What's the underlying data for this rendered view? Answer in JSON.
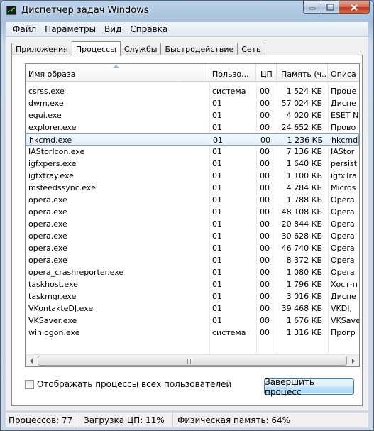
{
  "window": {
    "title": "Диспетчер задач Windows"
  },
  "menu": [
    {
      "first": "Ф",
      "rest": "айл"
    },
    {
      "first": "П",
      "rest": "араметры"
    },
    {
      "first": "В",
      "rest": "ид"
    },
    {
      "first": "С",
      "rest": "правка"
    }
  ],
  "tabs": [
    "Приложения",
    "Процессы",
    "Службы",
    "Быстродействие",
    "Сеть"
  ],
  "active_tab": 1,
  "columns": {
    "name": "Имя образа",
    "user": "Пользо...",
    "cpu": "ЦП",
    "mem": "Память (ч...",
    "desc": "Описа"
  },
  "processes": [
    {
      "name": "csrss.exe",
      "user": "система",
      "cpu": "00",
      "mem": "1 524 КБ",
      "desc": "Проце"
    },
    {
      "name": "dwm.exe",
      "user": "01",
      "cpu": "00",
      "mem": "57 024 КБ",
      "desc": "Диспе"
    },
    {
      "name": "egui.exe",
      "user": "01",
      "cpu": "00",
      "mem": "4 020 КБ",
      "desc": "ESET N"
    },
    {
      "name": "explorer.exe",
      "user": "01",
      "cpu": "00",
      "mem": "24 652 КБ",
      "desc": "Прово"
    },
    {
      "name": "hkcmd.exe",
      "user": "01",
      "cpu": "00",
      "mem": "1 236 КБ",
      "desc": "hkcmd"
    },
    {
      "name": "IAStorIcon.exe",
      "user": "01",
      "cpu": "00",
      "mem": "7 136 КБ",
      "desc": "IAStor"
    },
    {
      "name": "igfxpers.exe",
      "user": "01",
      "cpu": "00",
      "mem": "1 640 КБ",
      "desc": "persist"
    },
    {
      "name": "igfxtray.exe",
      "user": "01",
      "cpu": "00",
      "mem": "1 100 КБ",
      "desc": "igfxTra"
    },
    {
      "name": "msfeedssync.exe",
      "user": "01",
      "cpu": "00",
      "mem": "4 284 КБ",
      "desc": "Micros"
    },
    {
      "name": "opera.exe",
      "user": "01",
      "cpu": "00",
      "mem": "1 788 КБ",
      "desc": "Opera"
    },
    {
      "name": "opera.exe",
      "user": "01",
      "cpu": "00",
      "mem": "48 108 КБ",
      "desc": "Opera"
    },
    {
      "name": "opera.exe",
      "user": "01",
      "cpu": "00",
      "mem": "20 844 КБ",
      "desc": "Opera"
    },
    {
      "name": "opera.exe",
      "user": "01",
      "cpu": "00",
      "mem": "30 628 КБ",
      "desc": "Opera"
    },
    {
      "name": "opera.exe",
      "user": "01",
      "cpu": "00",
      "mem": "46 740 КБ",
      "desc": "Opera"
    },
    {
      "name": "opera.exe",
      "user": "01",
      "cpu": "00",
      "mem": "8 372 КБ",
      "desc": "Opera"
    },
    {
      "name": "opera_crashreporter.exe",
      "user": "01",
      "cpu": "00",
      "mem": "1 080 КБ",
      "desc": "Opera"
    },
    {
      "name": "taskhost.exe",
      "user": "01",
      "cpu": "00",
      "mem": "1 796 КБ",
      "desc": "Хост-п"
    },
    {
      "name": "taskmgr.exe",
      "user": "01",
      "cpu": "00",
      "mem": "3 016 КБ",
      "desc": "Диспе"
    },
    {
      "name": "VKontakteDJ.exe",
      "user": "01",
      "cpu": "00",
      "mem": "39 468 КБ",
      "desc": "VKDJ,"
    },
    {
      "name": "VKSaver.exe",
      "user": "01",
      "cpu": "00",
      "mem": "1 676 КБ",
      "desc": "VKSave"
    },
    {
      "name": "winlogon.exe",
      "user": "система",
      "cpu": "00",
      "mem": "1 316 КБ",
      "desc": "Прогр"
    }
  ],
  "selected_row": 4,
  "show_all_users": {
    "label": "Отображать процессы всех пользователей",
    "checked": false
  },
  "end_process_label": "Завершить процесс",
  "status": {
    "processes": "Процессов: 77",
    "cpu": "Загрузка ЦП: 11%",
    "memory": "Физическая память: 64%"
  }
}
